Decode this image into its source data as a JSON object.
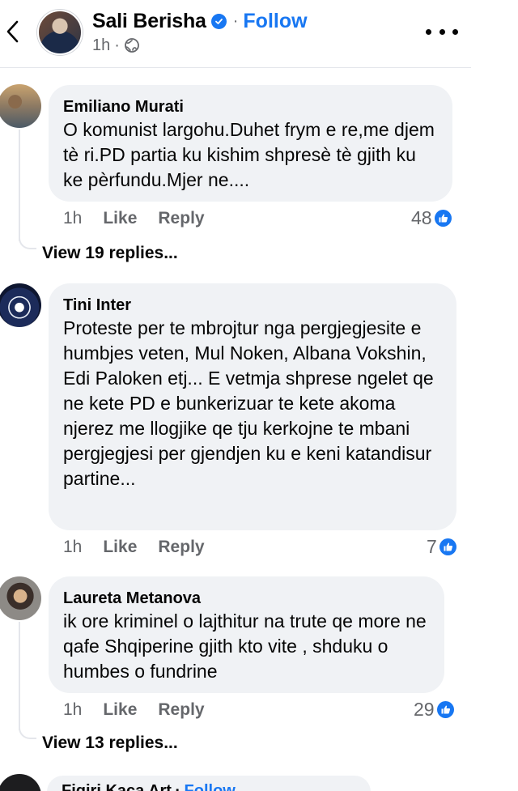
{
  "header": {
    "page_name": "Sali Berisha",
    "separator": "·",
    "follow_label": "Follow",
    "time": "1h",
    "meta_separator": "·",
    "audience_icon": "globe-icon",
    "back_icon": "chevron-left-icon",
    "more_icon": "more-horizontal-icon",
    "verified_icon": "verified-badge-icon"
  },
  "comments": [
    {
      "author": "Emiliano Murati",
      "text": "O komunist largohu.Duhet frym e re,me djem tè ri.PD partia ku kishim shpresè tè gjith ku ke pèrfundu.Mjer ne....",
      "time": "1h",
      "like_label": "Like",
      "reply_label": "Reply",
      "reaction_count": "48",
      "view_replies": "View 19 replies..."
    },
    {
      "author": "Tini Inter",
      "text": "Proteste per te mbrojtur nga pergjegjesite e humbjes veten, Mul Noken, Albana Vokshin, Edi Paloken etj... E vetmja shprese ngelet qe ne kete PD e bunkerizuar te kete akoma njerez me llogjike qe tju kerkojne te mbani pergjegjesi per gjendjen ku e keni katandisur partine...",
      "time": "1h",
      "like_label": "Like",
      "reply_label": "Reply",
      "reaction_count": "7"
    },
    {
      "author": "Laureta Metanova",
      "text": "ik ore kriminel  o lajthitur na trute qe more ne qafe Shqiperine gjith kto vite , shduku o humbes o fundrine",
      "time": "1h",
      "like_label": "Like",
      "reply_label": "Reply",
      "reaction_count": "29",
      "view_replies": "View 13 replies..."
    }
  ],
  "next_comment": {
    "author": "Figiri Kaca Art",
    "separator": "·",
    "follow_label": "Follow"
  },
  "colors": {
    "accent": "#1877f2",
    "bubble": "#f0f2f5",
    "secondary_text": "#65676b"
  }
}
